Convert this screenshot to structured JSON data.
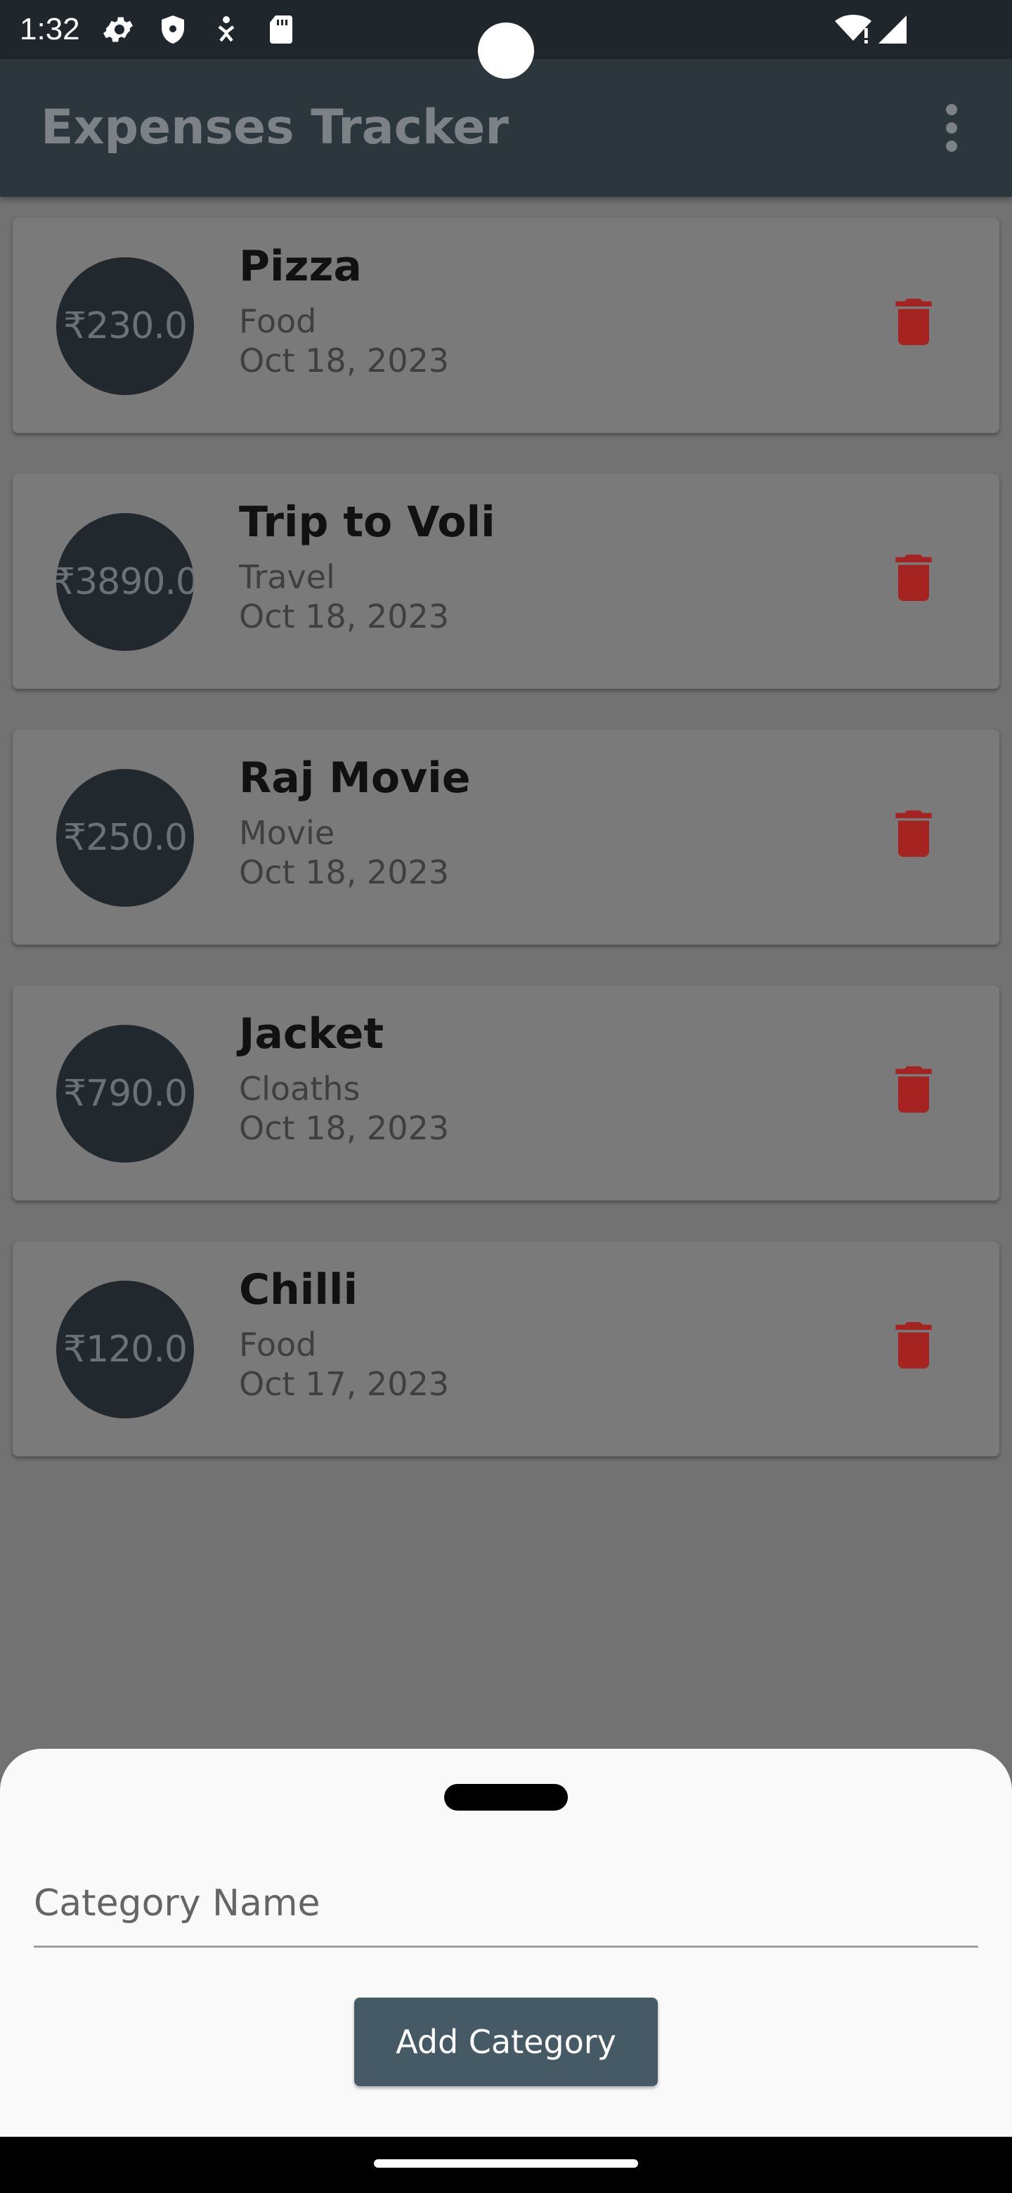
{
  "status_bar": {
    "time": "1:32",
    "icons": [
      "settings-gear-icon",
      "shield-icon",
      "accessibility-icon",
      "sd-card-icon",
      "wifi-alert-icon",
      "cell-signal-icon"
    ]
  },
  "app_bar": {
    "title": "Expenses Tracker",
    "menu_icon": "more-vert-icon"
  },
  "expenses": [
    {
      "amount": "₹230.0",
      "title": "Pizza",
      "category": "Food",
      "date": "Oct 18, 2023"
    },
    {
      "amount": "₹3890.0",
      "title": "Trip to Voli",
      "category": "Travel",
      "date": "Oct 18, 2023"
    },
    {
      "amount": "₹250.0",
      "title": "Raj Movie",
      "category": "Movie",
      "date": "Oct 18, 2023"
    },
    {
      "amount": "₹790.0",
      "title": "Jacket",
      "category": "Cloaths",
      "date": "Oct 18, 2023"
    },
    {
      "amount": "₹120.0",
      "title": "Chilli",
      "category": "Food",
      "date": "Oct 17, 2023"
    }
  ],
  "bottom_sheet": {
    "input_placeholder": "Category Name",
    "input_value": "",
    "button_label": "Add Category"
  },
  "colors": {
    "app_bar": "#2b363d",
    "scrim_background": "#727272",
    "avatar": "#22292e",
    "delete_icon": "#a52421",
    "button": "#455a64"
  }
}
